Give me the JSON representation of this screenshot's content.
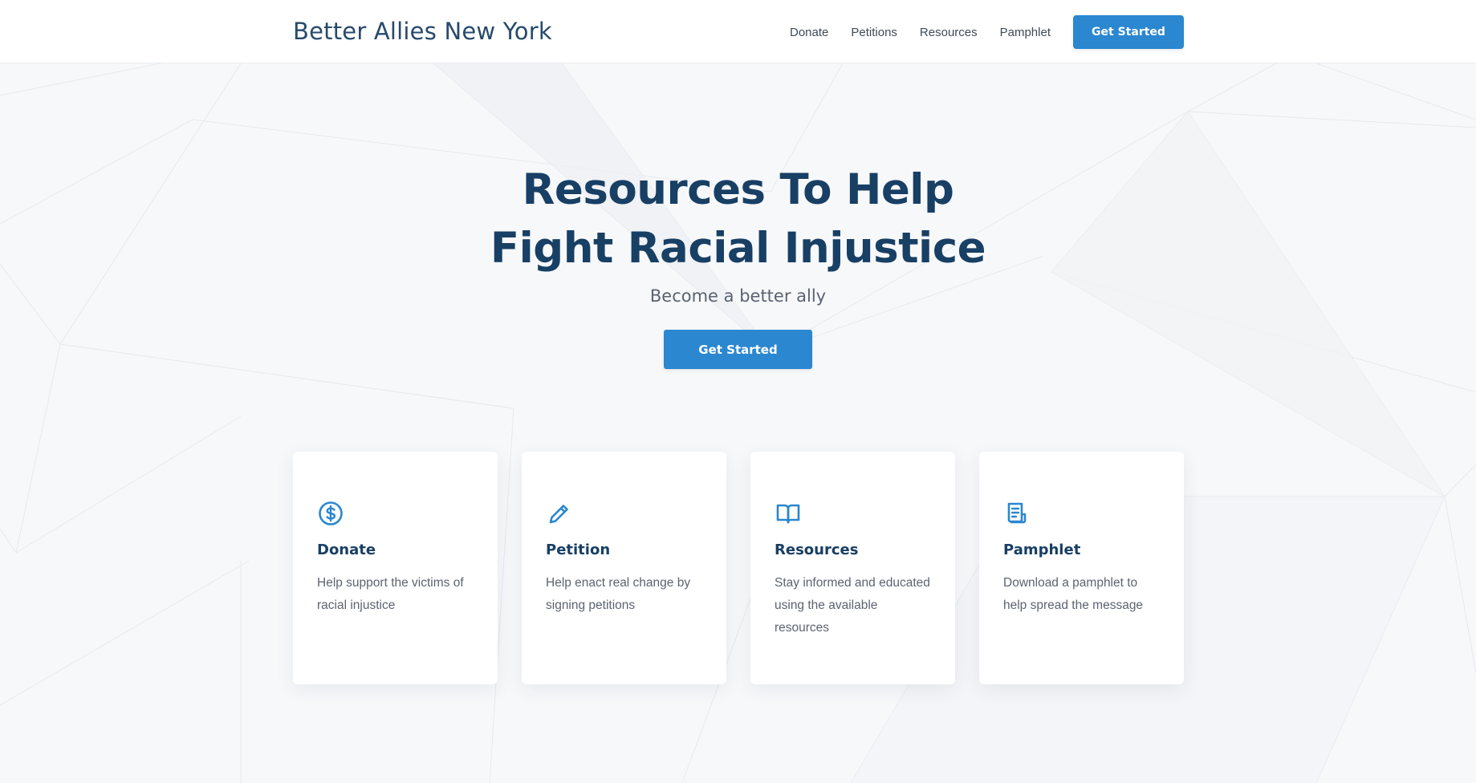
{
  "header": {
    "brand": "Better Allies New York",
    "nav": [
      "Donate",
      "Petitions",
      "Resources",
      "Pamphlet"
    ],
    "cta_label": "Get Started"
  },
  "hero": {
    "title_line1": "Resources To Help",
    "title_line2": "Fight Racial Injustice",
    "subtitle": "Become a better ally",
    "cta_label": "Get Started"
  },
  "cards": [
    {
      "icon": "dollar-circle-icon",
      "title": "Donate",
      "text": "Help support the victims of racial injustice"
    },
    {
      "icon": "pencil-icon",
      "title": "Petition",
      "text": "Help enact real change by signing petitions"
    },
    {
      "icon": "open-book-icon",
      "title": "Resources",
      "text": "Stay informed and educated using the available resources"
    },
    {
      "icon": "document-icon",
      "title": "Pamphlet",
      "text": "Download a pamphlet to help spread the message"
    }
  ],
  "colors": {
    "primary": "#2a87d0",
    "heading": "#183f64",
    "body_text": "#5c6470",
    "background": "#f7f8fa"
  }
}
